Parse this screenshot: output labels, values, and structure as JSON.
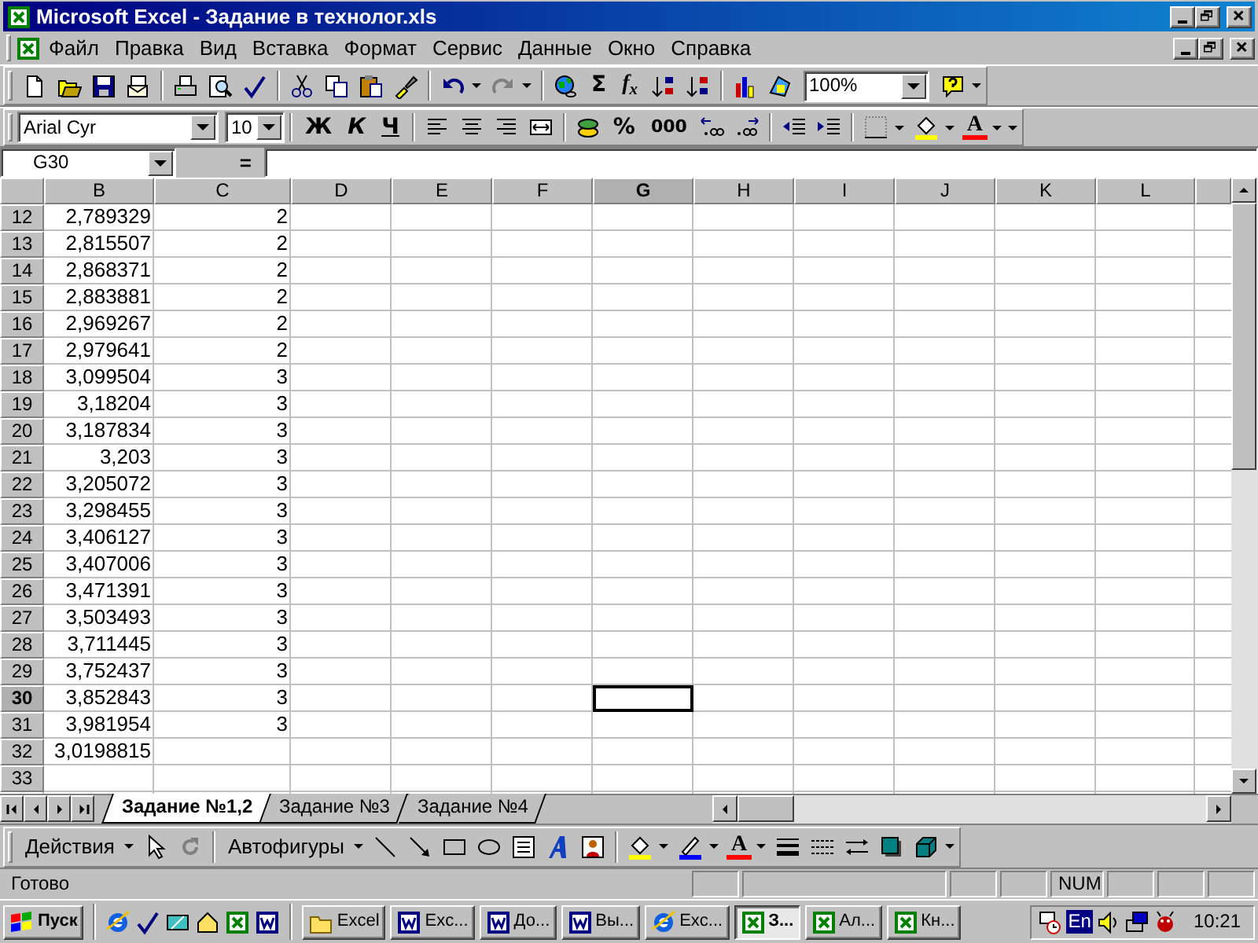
{
  "window": {
    "title": "Microsoft Excel - Задание в технолог.xls"
  },
  "menu": [
    "Файл",
    "Правка",
    "Вид",
    "Вставка",
    "Формат",
    "Сервис",
    "Данные",
    "Окно",
    "Справка"
  ],
  "standard_toolbar": {
    "autosum": "Σ",
    "function": "f$_{x}$",
    "zoom": "100%"
  },
  "formatting_toolbar": {
    "font": "Arial Cyr",
    "size": "10",
    "bold": "Ж",
    "italic": "К",
    "underline": "Ч",
    "percent": "%",
    "thousands": "000",
    "font_color": "A"
  },
  "formula_bar": {
    "name_box": "G30",
    "equals": "="
  },
  "columns": [
    {
      "label": "B",
      "selected": false
    },
    {
      "label": "C",
      "selected": false
    },
    {
      "label": "D",
      "selected": false
    },
    {
      "label": "E",
      "selected": false
    },
    {
      "label": "F",
      "selected": false
    },
    {
      "label": "G",
      "selected": true
    },
    {
      "label": "H",
      "selected": false
    },
    {
      "label": "I",
      "selected": false
    },
    {
      "label": "J",
      "selected": false
    },
    {
      "label": "K",
      "selected": false
    },
    {
      "label": "L",
      "selected": false
    }
  ],
  "rows": [
    {
      "label": "12",
      "selected": false,
      "cells": [
        "2,789329",
        "2"
      ]
    },
    {
      "label": "13",
      "selected": false,
      "cells": [
        "2,815507",
        "2"
      ]
    },
    {
      "label": "14",
      "selected": false,
      "cells": [
        "2,868371",
        "2"
      ]
    },
    {
      "label": "15",
      "selected": false,
      "cells": [
        "2,883881",
        "2"
      ]
    },
    {
      "label": "16",
      "selected": false,
      "cells": [
        "2,969267",
        "2"
      ]
    },
    {
      "label": "17",
      "selected": false,
      "cells": [
        "2,979641",
        "2"
      ]
    },
    {
      "label": "18",
      "selected": false,
      "cells": [
        "3,099504",
        "3"
      ]
    },
    {
      "label": "19",
      "selected": false,
      "cells": [
        "3,18204",
        "3"
      ]
    },
    {
      "label": "20",
      "selected": false,
      "cells": [
        "3,187834",
        "3"
      ]
    },
    {
      "label": "21",
      "selected": false,
      "cells": [
        "3,203",
        "3"
      ]
    },
    {
      "label": "22",
      "selected": false,
      "cells": [
        "3,205072",
        "3"
      ]
    },
    {
      "label": "23",
      "selected": false,
      "cells": [
        "3,298455",
        "3"
      ]
    },
    {
      "label": "24",
      "selected": false,
      "cells": [
        "3,406127",
        "3"
      ]
    },
    {
      "label": "25",
      "selected": false,
      "cells": [
        "3,407006",
        "3"
      ]
    },
    {
      "label": "26",
      "selected": false,
      "cells": [
        "3,471391",
        "3"
      ]
    },
    {
      "label": "27",
      "selected": false,
      "cells": [
        "3,503493",
        "3"
      ]
    },
    {
      "label": "28",
      "selected": false,
      "cells": [
        "3,711445",
        "3"
      ]
    },
    {
      "label": "29",
      "selected": false,
      "cells": [
        "3,752437",
        "3"
      ]
    },
    {
      "label": "30",
      "selected": true,
      "cells": [
        "3,852843",
        "3"
      ]
    },
    {
      "label": "31",
      "selected": false,
      "cells": [
        "3,981954",
        "3"
      ]
    },
    {
      "label": "32",
      "selected": false,
      "cells": [
        "3,0198815"
      ]
    },
    {
      "label": "33",
      "selected": false
    }
  ],
  "sheet_tabs": [
    {
      "label": "Задание №1,2",
      "selected": true
    },
    {
      "label": "Задание №3",
      "selected": false
    },
    {
      "label": "Задание №4",
      "selected": false
    }
  ],
  "drawing_toolbar": {
    "actions": "Действия",
    "autoshapes": "Автофигуры",
    "font_color": "A"
  },
  "status_bar": {
    "message": "Готово",
    "num": "NUM"
  },
  "taskbar": {
    "start": "Пуск",
    "tasks": [
      {
        "label": "Excel",
        "kind": "folder",
        "selected": false
      },
      {
        "label": "Exc...",
        "kind": "word",
        "selected": false
      },
      {
        "label": "До...",
        "kind": "word",
        "selected": false
      },
      {
        "label": "Вы...",
        "kind": "word",
        "selected": false
      },
      {
        "label": "Exc...",
        "kind": "browser",
        "selected": false
      },
      {
        "label": "З...",
        "kind": "excel",
        "selected": true
      },
      {
        "label": "Ал...",
        "kind": "excel",
        "selected": false
      },
      {
        "label": "Кн...",
        "kind": "excel",
        "selected": false
      }
    ],
    "language": "En",
    "clock": "10:21"
  }
}
